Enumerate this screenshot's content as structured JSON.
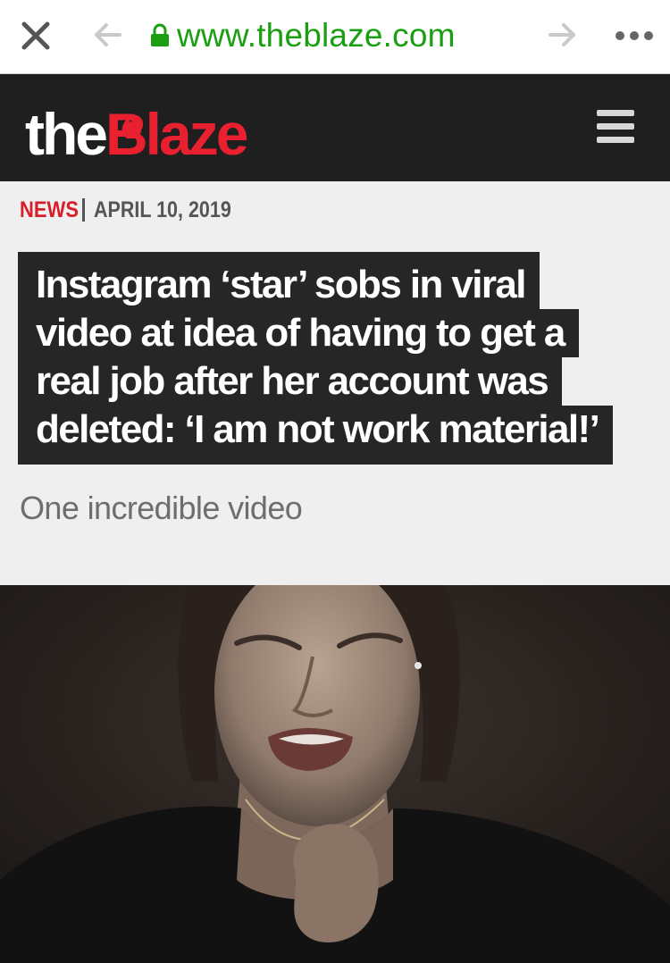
{
  "browser": {
    "url": "www.theblaze.com",
    "icons": {
      "close": "close-icon",
      "back": "back-arrow-icon",
      "forward": "forward-arrow-icon",
      "lock": "lock-icon",
      "more": "more-dots-icon"
    },
    "url_color": "#1a9e12"
  },
  "site": {
    "logo_the": "the",
    "logo_blaze": "Blaze",
    "brand_color": "#e8202f",
    "menu_icon": "hamburger-icon"
  },
  "article": {
    "category": "NEWS",
    "date": "APRIL 10, 2019",
    "headline_lines": [
      "Instagram ‘star’ sobs in viral",
      "video at idea of having to get a",
      "real job after her account was",
      "deleted: ‘I am not work material!’"
    ],
    "subtitle": "One incredible video",
    "image_alt": "crying-woman-photo"
  }
}
